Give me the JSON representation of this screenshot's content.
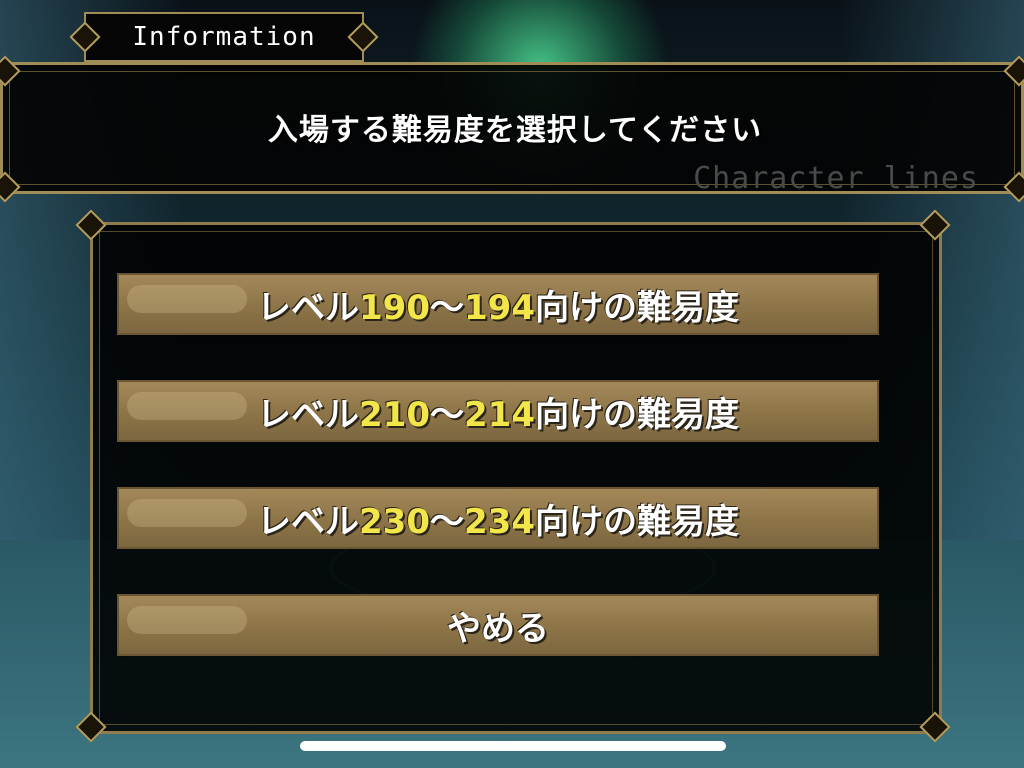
{
  "header": {
    "tab_title": "Information",
    "message": "入場する難易度を選択してください",
    "character_lines": "Character lines"
  },
  "options": [
    {
      "prefix": "レベル",
      "low": "190",
      "sep": "〜",
      "high": "194",
      "suffix": "向けの難易度"
    },
    {
      "prefix": "レベル",
      "low": "210",
      "sep": "〜",
      "high": "214",
      "suffix": "向けの難易度"
    },
    {
      "prefix": "レベル",
      "low": "230",
      "sep": "〜",
      "high": "234",
      "suffix": "向けの難易度"
    }
  ],
  "cancel_label": "やめる",
  "colors": {
    "frame_gold": "#a08c55",
    "button_tan": "#8d7447",
    "level_number_yellow": "#f2e64a",
    "panel_bg": "#000000"
  }
}
